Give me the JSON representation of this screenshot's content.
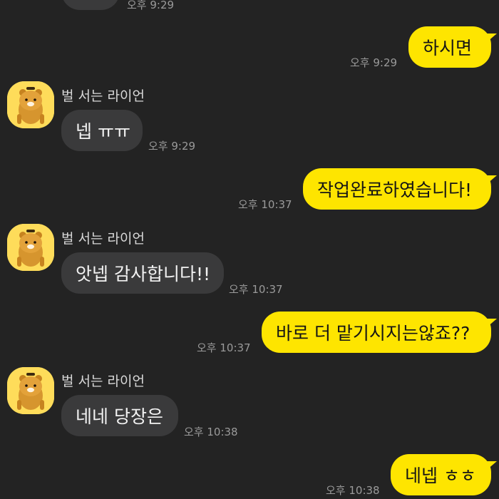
{
  "contact": {
    "name": "벌 서는 라이언"
  },
  "messages": [
    {
      "id": "m0",
      "side": "in",
      "text": "",
      "time": "오후 9:29"
    },
    {
      "id": "m1",
      "side": "out",
      "text": "하시면",
      "time": "오후 9:29"
    },
    {
      "id": "m2",
      "side": "in",
      "text": "넵 ㅠㅠ",
      "time": "오후 9:29"
    },
    {
      "id": "m3",
      "side": "out",
      "text": "작업완료하였습니다!",
      "time": "오후 10:37"
    },
    {
      "id": "m4",
      "side": "in",
      "text": "앗넵 감사합니다!!",
      "time": "오후 10:37"
    },
    {
      "id": "m5",
      "side": "out",
      "text": "바로 더 맡기시지는않죠??",
      "time": "오후 10:37"
    },
    {
      "id": "m6",
      "side": "in",
      "text": "네네 당장은",
      "time": "오후 10:38"
    },
    {
      "id": "m7",
      "side": "out",
      "text": "네넵 ㅎㅎ",
      "time": "오후 10:38"
    }
  ],
  "colors": {
    "background": "#232323",
    "incoming_bubble": "#3a3a3b",
    "outgoing_bubble": "#fee500",
    "timestamp": "#9a9a9a"
  },
  "icons": {
    "avatar": "ryan-character-icon"
  }
}
